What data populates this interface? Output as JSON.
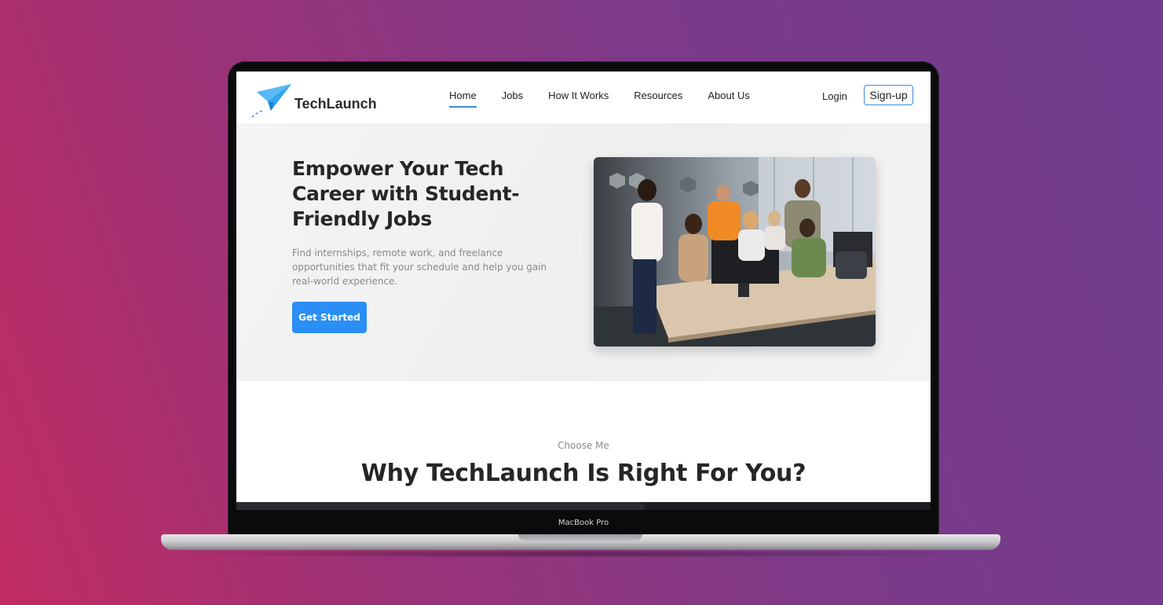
{
  "device": {
    "model_label": "MacBook Pro"
  },
  "nav": {
    "brand": "TechLaunch",
    "links": [
      {
        "label": "Home",
        "active": true
      },
      {
        "label": "Jobs",
        "active": false
      },
      {
        "label": "How It Works",
        "active": false
      },
      {
        "label": "Resources",
        "active": false
      },
      {
        "label": "About Us",
        "active": false
      }
    ],
    "login": "Login",
    "signup": "Sign-up"
  },
  "hero": {
    "title": "Empower Your Tech Career with Student-Friendly Jobs",
    "description": "Find internships, remote work, and freelance opportunities that fit your schedule and help you gain real-world experience.",
    "cta": "Get Started"
  },
  "why": {
    "kicker": "Choose Me",
    "title": "Why TechLaunch Is Right For You?"
  },
  "colors": {
    "accent": "#2a8ef5",
    "nav_underline": "#3a8dde",
    "background_start": "#c12c62",
    "background_end": "#6f3c8e"
  },
  "icons": {
    "logo": "paper-plane-icon"
  }
}
